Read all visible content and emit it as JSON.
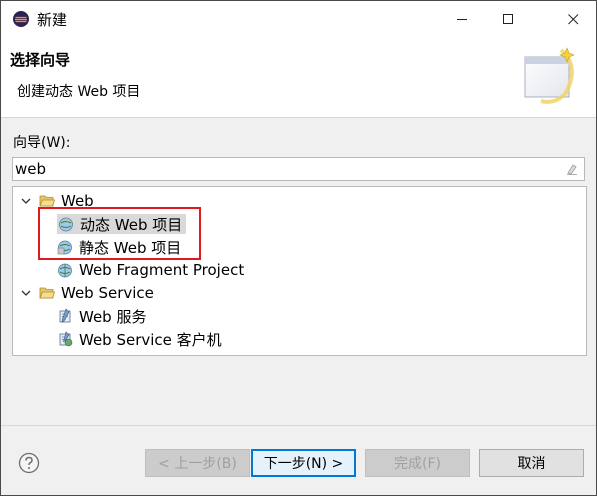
{
  "window": {
    "title": "新建"
  },
  "header": {
    "title": "选择向导",
    "description": "创建动态 Web 项目"
  },
  "filter": {
    "label": "向导(W):",
    "value": "web"
  },
  "tree": {
    "groups": [
      {
        "label": "Web",
        "expanded": true,
        "items": [
          {
            "label": "动态 Web 项目",
            "icon": "dynamic-web-project-icon",
            "selected": true
          },
          {
            "label": "静态 Web 项目",
            "icon": "static-web-project-icon",
            "selected": false
          },
          {
            "label": "Web Fragment Project",
            "icon": "web-fragment-project-icon",
            "selected": false
          }
        ]
      },
      {
        "label": "Web Service",
        "expanded": true,
        "items": [
          {
            "label": "Web 服务",
            "icon": "web-service-icon",
            "selected": false
          },
          {
            "label": "Web Service 客户机",
            "icon": "web-service-client-icon",
            "selected": false
          }
        ]
      }
    ]
  },
  "buttons": {
    "back": "< 上一步(B)",
    "next": "下一步(N) >",
    "finish": "完成(F)",
    "cancel": "取消"
  },
  "colors": {
    "highlight": "#e0191f",
    "default_button_border": "#0078d7",
    "selection": "#d9d9d9"
  }
}
